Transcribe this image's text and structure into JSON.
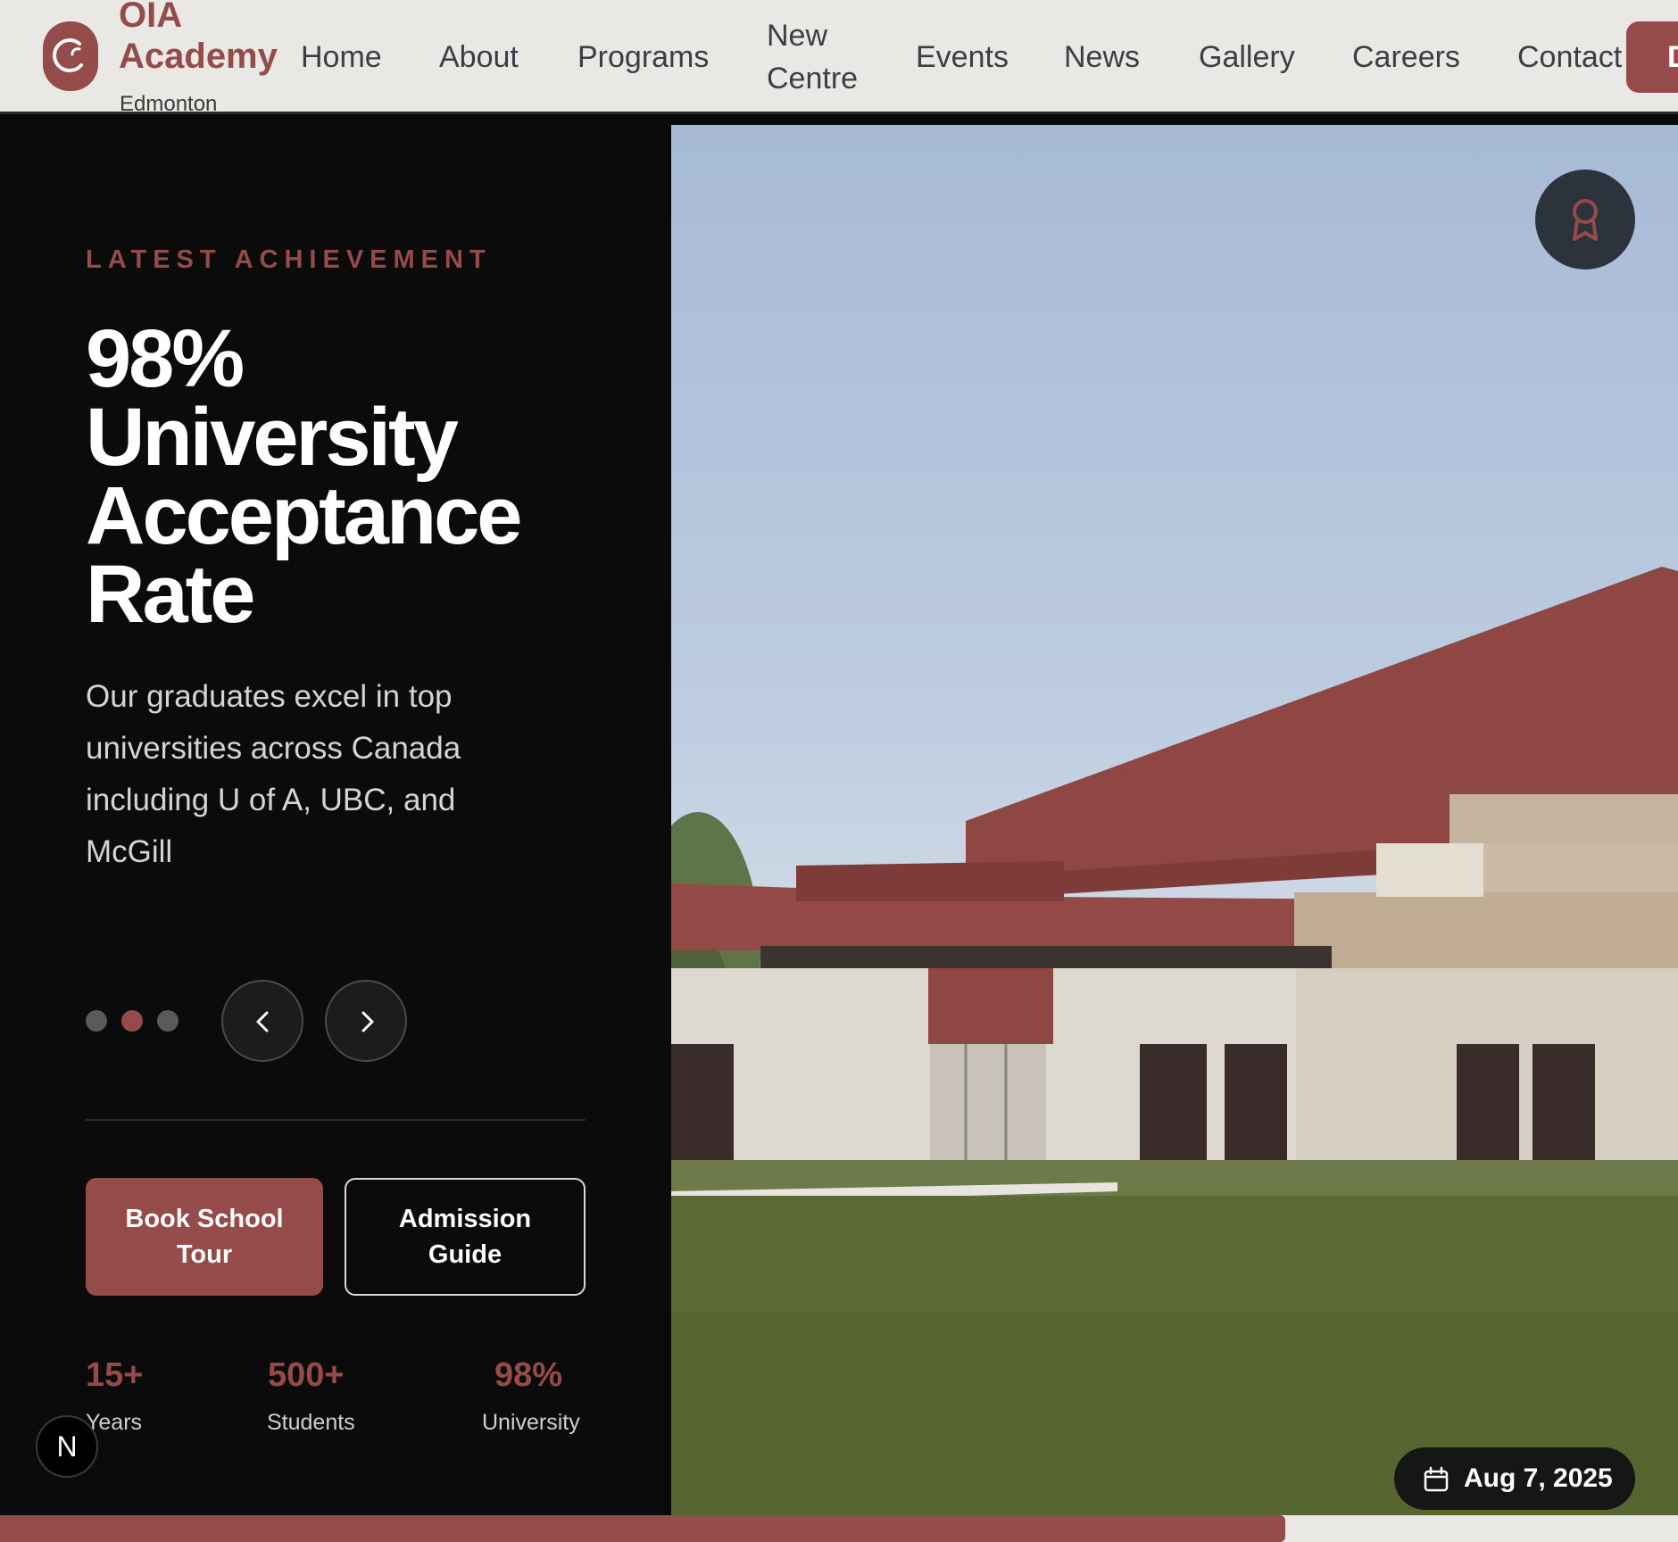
{
  "brand": {
    "name": "OIA\nAcademy",
    "city": "Edmonton",
    "accent_color": "#944b49"
  },
  "nav": {
    "items": [
      {
        "label": "Home"
      },
      {
        "label": "About"
      },
      {
        "label": "Programs"
      },
      {
        "label": "New\nCentre"
      },
      {
        "label": "Events"
      },
      {
        "label": "News"
      },
      {
        "label": "Gallery"
      },
      {
        "label": "Careers"
      },
      {
        "label": "Contact"
      }
    ],
    "cta_label": "D"
  },
  "hero": {
    "eyebrow": "LATEST ACHIEVEMENT",
    "headline": [
      "98%",
      "University",
      "Acceptance",
      "Rate"
    ],
    "description": "Our graduates excel in top universities across Canada including U of A, UBC, and McGill",
    "slide_count": 3,
    "active_slide": 2,
    "prev_icon": "chevron-left-icon",
    "next_icon": "chevron-right-icon",
    "primary_button": "Book School Tour",
    "secondary_button": "Admission Guide",
    "stats": [
      {
        "value": "15+",
        "label": "Years"
      },
      {
        "value": "500+",
        "label": "Students"
      },
      {
        "value": "98%",
        "label": "University"
      }
    ],
    "badge_letter": "N",
    "award_icon": "award-ribbon-icon",
    "date": "Aug 7, 2025",
    "date_icon": "calendar-icon"
  },
  "slide_progress": 0.766
}
